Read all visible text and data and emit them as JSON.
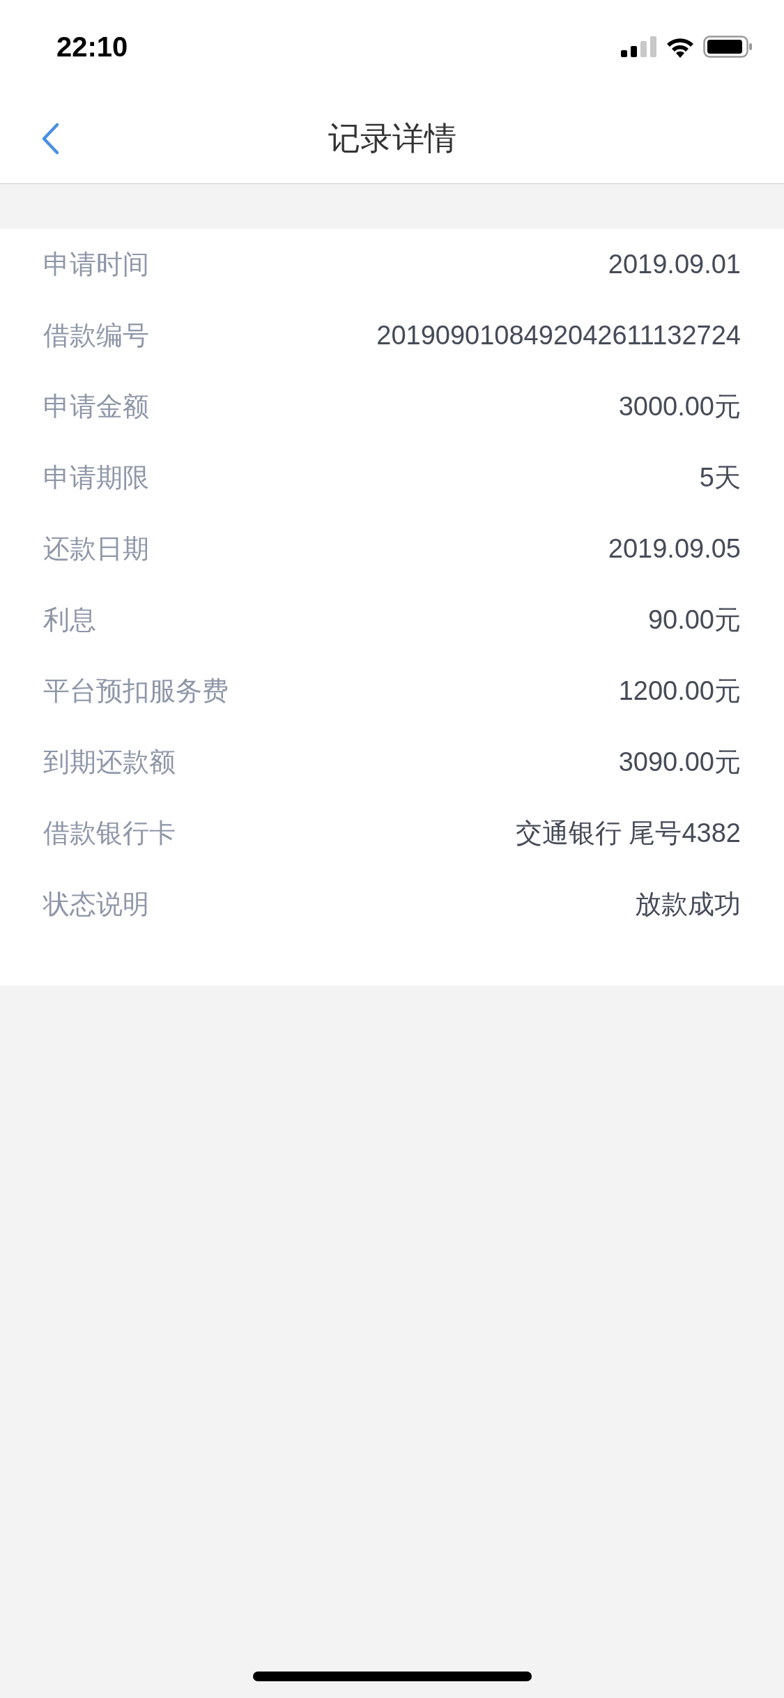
{
  "status_bar": {
    "time": "22:10"
  },
  "nav_bar": {
    "title": "记录详情"
  },
  "details": [
    {
      "label": "申请时间",
      "value": "2019.09.01"
    },
    {
      "label": "借款编号",
      "value": "2019090108492042611132724"
    },
    {
      "label": "申请金额",
      "value": "3000.00元"
    },
    {
      "label": "申请期限",
      "value": "5天"
    },
    {
      "label": "还款日期",
      "value": "2019.09.05"
    },
    {
      "label": "利息",
      "value": "90.00元"
    },
    {
      "label": "平台预扣服务费",
      "value": "1200.00元"
    },
    {
      "label": "到期还款额",
      "value": "3090.00元"
    },
    {
      "label": "借款银行卡",
      "value": "交通银行 尾号4382"
    },
    {
      "label": "状态说明",
      "value": "放款成功"
    }
  ]
}
